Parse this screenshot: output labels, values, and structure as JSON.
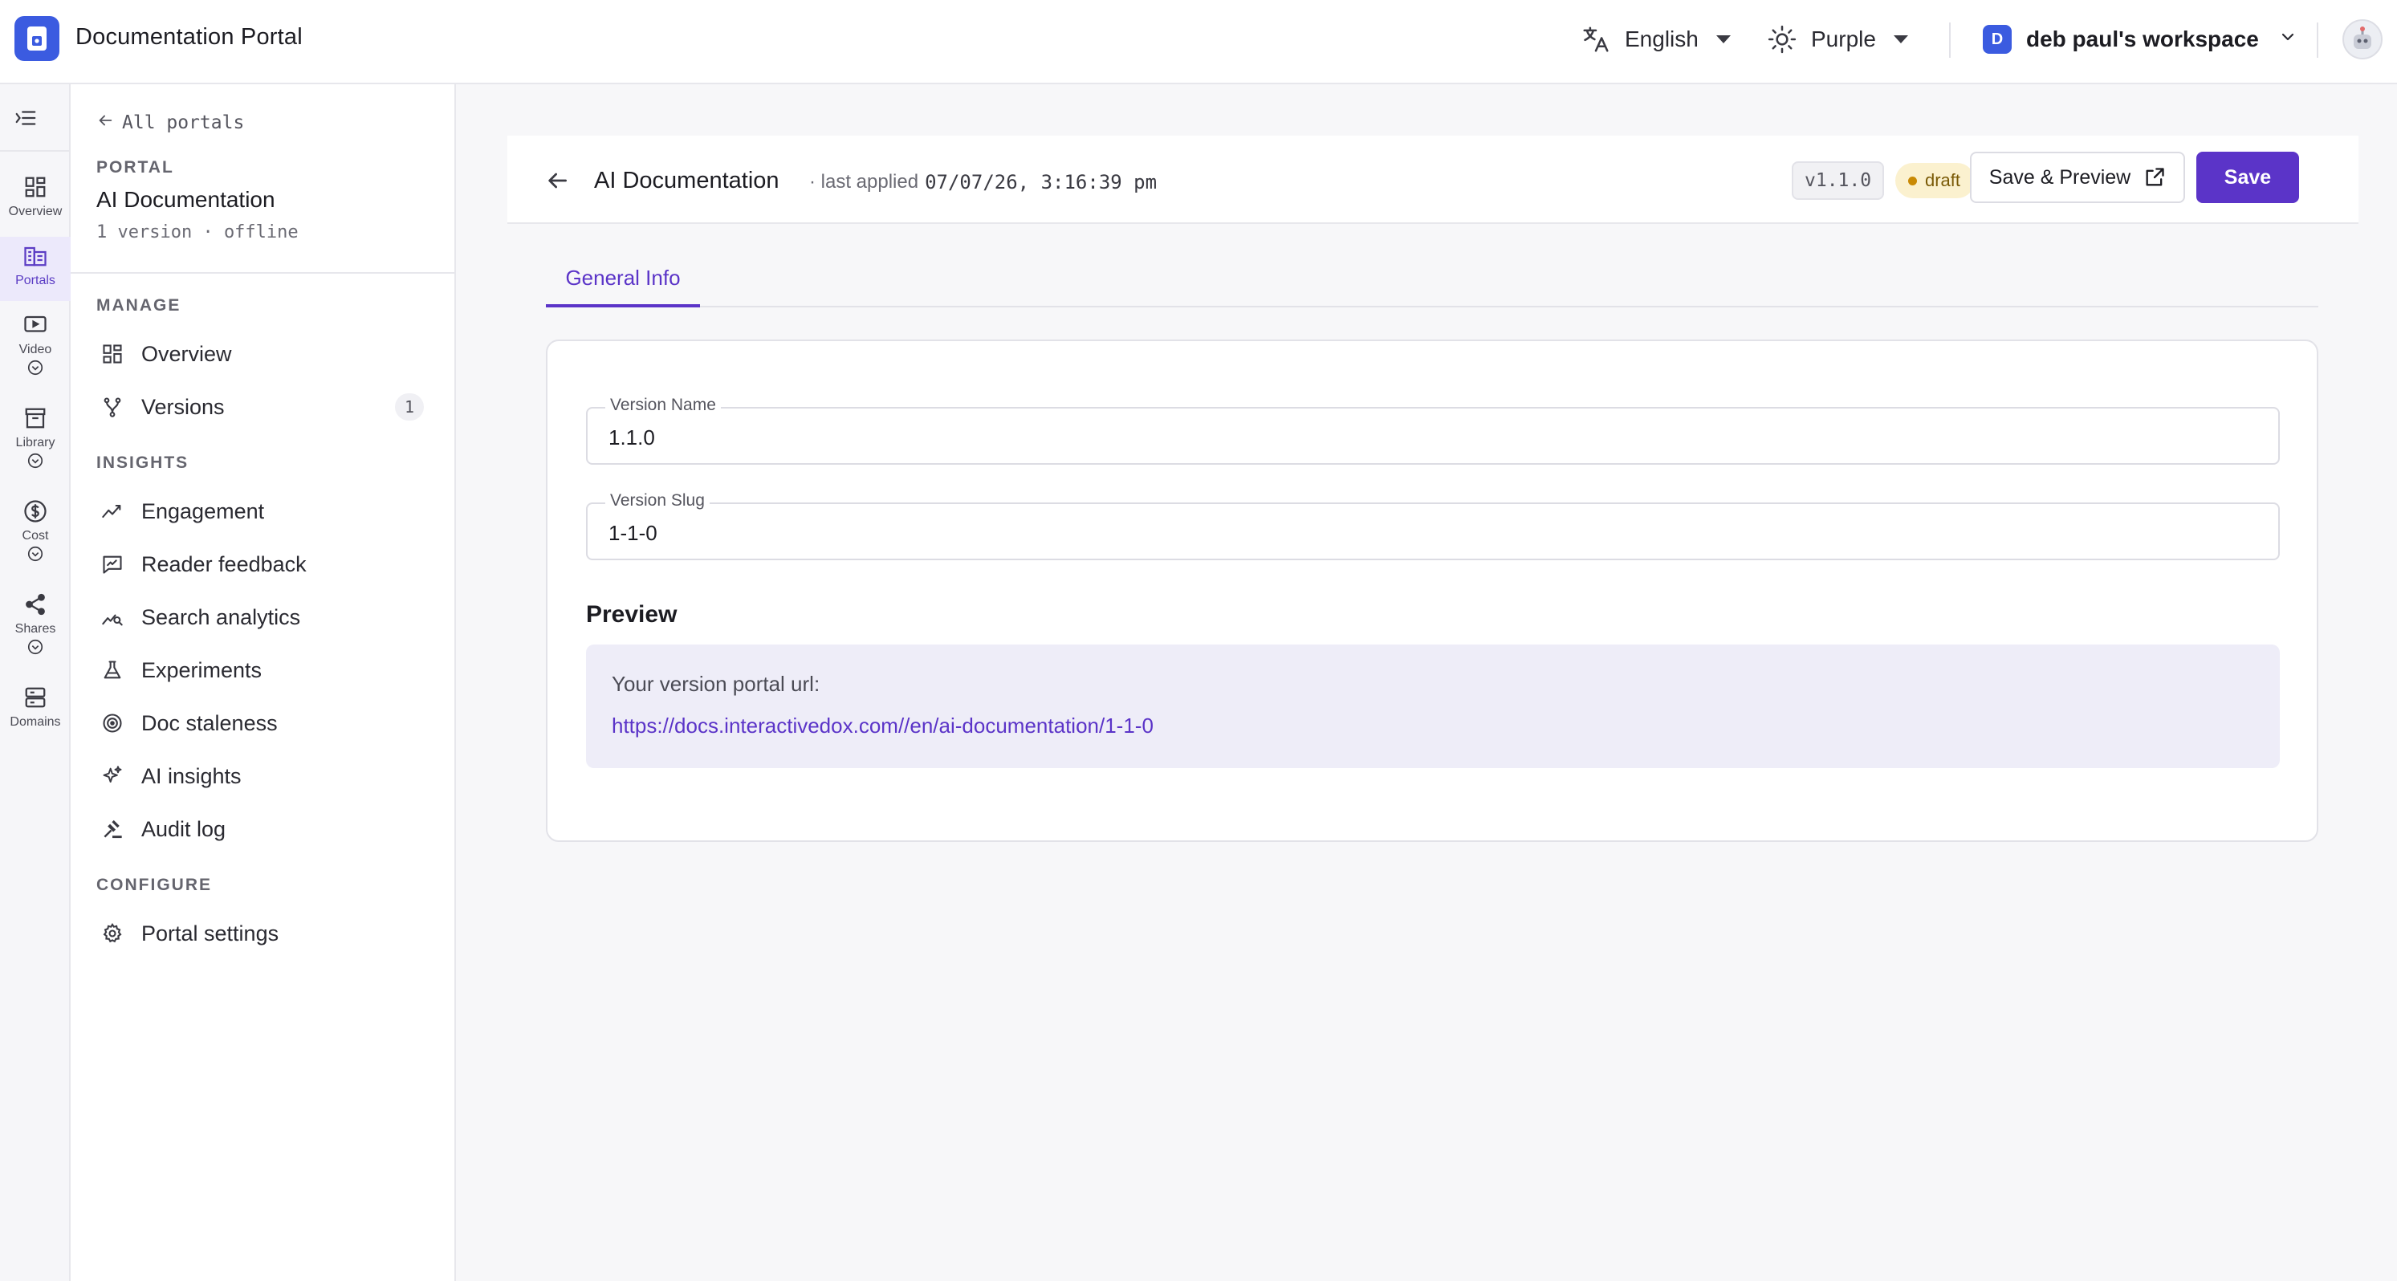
{
  "app": {
    "title": "Documentation Portal",
    "icon": "book-icon",
    "brand_color": "#3b5be0"
  },
  "header": {
    "language": {
      "label": "English",
      "icon": "translate-icon"
    },
    "theme": {
      "label": "Purple",
      "icon": "sun-icon"
    },
    "workspace": {
      "badge": "D",
      "name": "deb paul's workspace"
    },
    "avatar": "robot-avatar"
  },
  "rail": {
    "items": [
      {
        "label": "Overview",
        "icon": "grid-icon",
        "active": false,
        "expandable": false
      },
      {
        "label": "Portals",
        "icon": "building-icon",
        "active": true,
        "expandable": false
      },
      {
        "label": "Video",
        "icon": "video-icon",
        "active": false,
        "expandable": true
      },
      {
        "label": "Library",
        "icon": "archive-icon",
        "active": false,
        "expandable": true
      },
      {
        "label": "Cost",
        "icon": "dollar-icon",
        "active": false,
        "expandable": true
      },
      {
        "label": "Shares",
        "icon": "share-icon",
        "active": false,
        "expandable": true
      },
      {
        "label": "Domains",
        "icon": "server-icon",
        "active": false,
        "expandable": false
      }
    ]
  },
  "sidebar": {
    "back_label": "All portals",
    "eyebrow": "PORTAL",
    "portal_name": "AI Documentation",
    "meta": "1 version · offline",
    "sections": {
      "manage": "MANAGE",
      "insights": "INSIGHTS",
      "configure": "CONFIGURE"
    },
    "manage_items": [
      {
        "label": "Overview",
        "icon": "dashboard-icon"
      },
      {
        "label": "Versions",
        "icon": "branch-icon",
        "count": "1"
      }
    ],
    "insights_items": [
      {
        "label": "Engagement",
        "icon": "trend-icon"
      },
      {
        "label": "Reader feedback",
        "icon": "feedback-icon"
      },
      {
        "label": "Search analytics",
        "icon": "search-analytics-icon"
      },
      {
        "label": "Experiments",
        "icon": "flask-icon"
      },
      {
        "label": "Doc staleness",
        "icon": "target-icon"
      },
      {
        "label": "AI insights",
        "icon": "sparkle-icon"
      },
      {
        "label": "Audit log",
        "icon": "gavel-icon"
      }
    ],
    "configure_items": [
      {
        "label": "Portal settings",
        "icon": "gear-icon"
      }
    ]
  },
  "subheader": {
    "title": "AI Documentation",
    "meta_prefix": "· last applied",
    "timestamp": "07/07/26, 3:16:39 pm",
    "version": "v1.1.0",
    "status": "draft",
    "save_preview_label": "Save & Preview",
    "save_label": "Save"
  },
  "tabs": [
    {
      "label": "General Info",
      "active": true
    }
  ],
  "form": {
    "version_name": {
      "label": "Version Name",
      "value": "1.1.0"
    },
    "version_slug": {
      "label": "Version Slug",
      "value": "1-1-0"
    }
  },
  "preview": {
    "title": "Preview",
    "label": "Your version portal url:",
    "url": "https://docs.interactivedox.com//en/ai-documentation/1-1-0"
  },
  "colors": {
    "accent": "#5b34c8",
    "draft_bg": "#fbf1cf",
    "draft_dot": "#c98a05",
    "preview_bg": "#eeedf8"
  }
}
